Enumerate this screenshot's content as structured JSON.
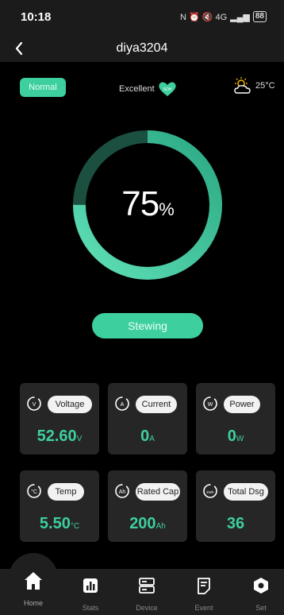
{
  "status": {
    "time": "10:18",
    "icons": "N ⏰ 🔇 4G",
    "battery": "88"
  },
  "header": {
    "title": "diya3204"
  },
  "badge": {
    "normal": "Normal"
  },
  "health": {
    "label": "Excellent",
    "icon_text": "SOH"
  },
  "weather": {
    "temp": "25°C"
  },
  "soc": {
    "value": "75",
    "unit": "%",
    "fraction": 0.75
  },
  "state": {
    "label": "Stewing"
  },
  "cards": [
    {
      "label": "Voltage",
      "value": "52.60",
      "unit": "V",
      "icon_text": "V"
    },
    {
      "label": "Current",
      "value": "0",
      "unit": "A",
      "icon_text": "A"
    },
    {
      "label": "Power",
      "value": "0",
      "unit": "W",
      "icon_text": "W"
    },
    {
      "label": "Temp",
      "value": "5.50",
      "unit": "°C",
      "icon_text": "°C"
    },
    {
      "label": "Rated Cap",
      "value": "200",
      "unit": "Ah",
      "icon_text": "Ah"
    },
    {
      "label": "Total Dsg",
      "value": "36",
      "unit": "",
      "icon_text": "kWh"
    }
  ],
  "nav": [
    {
      "label": "Home"
    },
    {
      "label": "Stats"
    },
    {
      "label": "Device"
    },
    {
      "label": "Event"
    },
    {
      "label": "Set"
    }
  ],
  "colors": {
    "accent": "#3ecf9e",
    "card_bg": "#262626",
    "bar_bg": "#1f1f1f"
  }
}
